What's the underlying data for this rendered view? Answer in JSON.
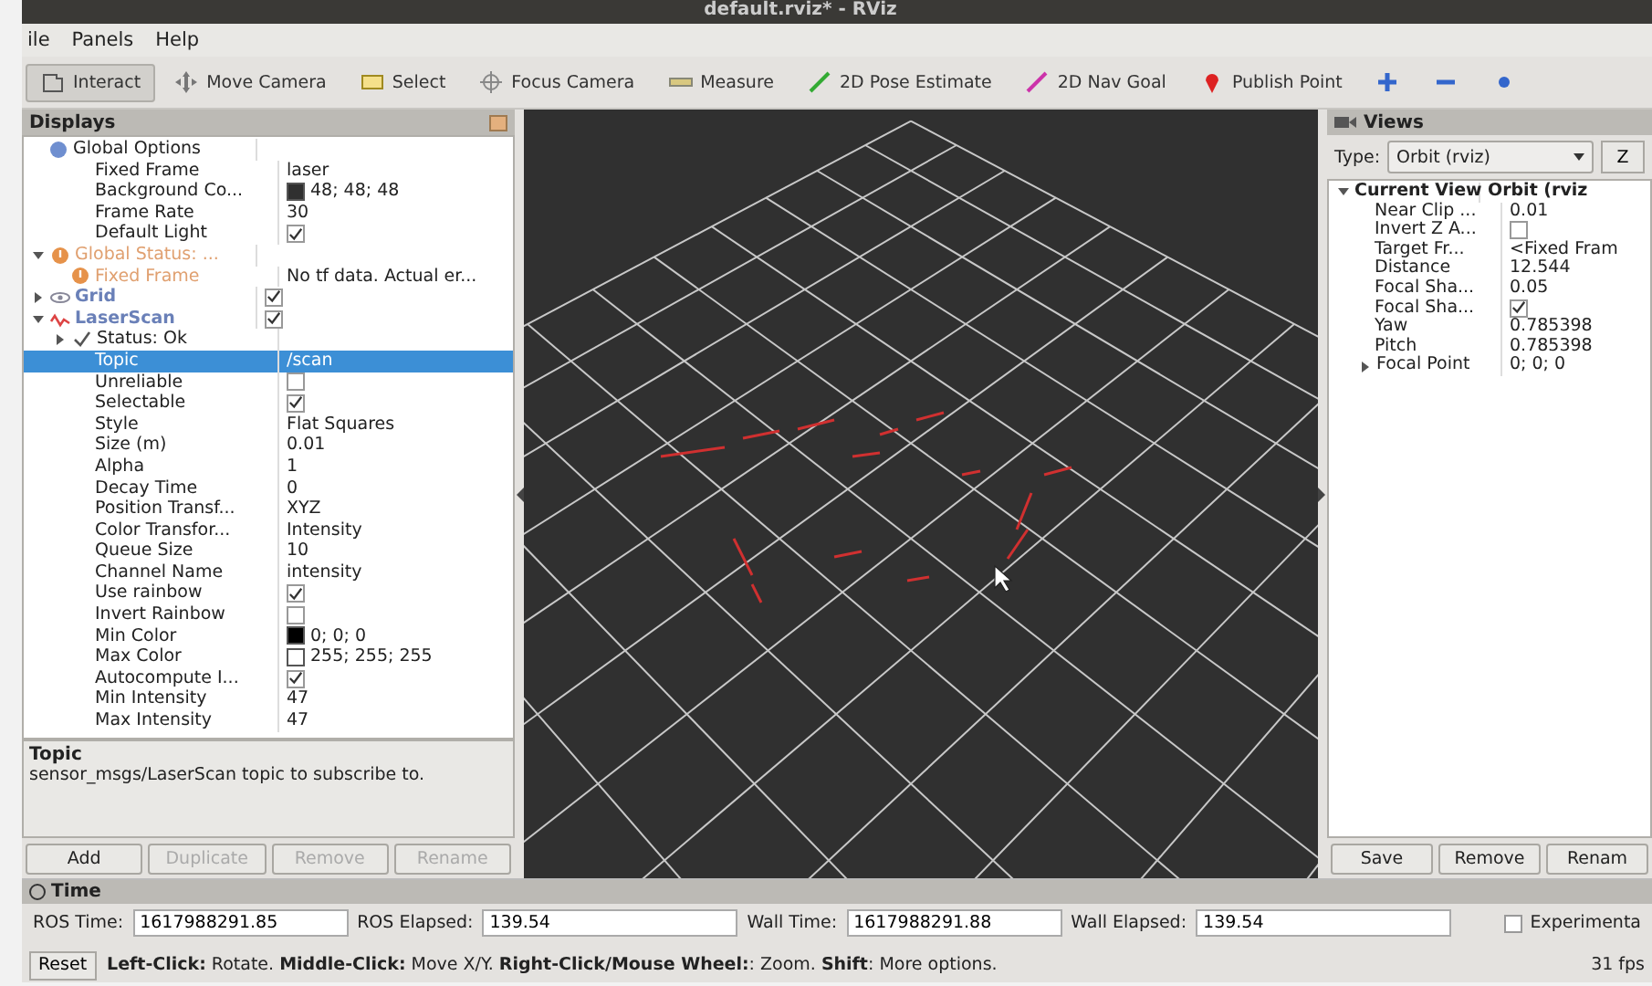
{
  "window": {
    "title": "default.rviz* - RViz"
  },
  "menu": [
    "ile",
    "Panels",
    "Help"
  ],
  "toolbar": [
    {
      "label": "Interact",
      "kind": "interact",
      "selected": true
    },
    {
      "label": "Move Camera",
      "kind": "move",
      "selected": false
    },
    {
      "label": "Select",
      "kind": "select",
      "selected": false
    },
    {
      "label": "Focus Camera",
      "kind": "focus",
      "selected": false
    },
    {
      "label": "Measure",
      "kind": "measure",
      "selected": false
    },
    {
      "label": "2D Pose Estimate",
      "kind": "pose",
      "selected": false
    },
    {
      "label": "2D Nav Goal",
      "kind": "goal",
      "selected": false
    },
    {
      "label": "Publish Point",
      "kind": "pin",
      "selected": false
    },
    {
      "kind": "plus",
      "selected": false
    },
    {
      "kind": "minus",
      "selected": false
    },
    {
      "kind": "dot",
      "selected": false
    }
  ],
  "displays": {
    "title": "Displays",
    "items": [
      {
        "label": "Global Options",
        "kind": "group",
        "selected": false,
        "children": [
          {
            "label": "Fixed Frame",
            "kind": "property",
            "value": "laser",
            "selected": false
          },
          {
            "label": "Background Co...",
            "kind": "property",
            "color": "#303030",
            "value": "48; 48; 48",
            "selected": false
          },
          {
            "label": "Frame Rate",
            "kind": "property",
            "value": "30",
            "selected": false
          },
          {
            "label": "Default Light",
            "kind": "property",
            "checked": true,
            "selected": false
          }
        ]
      },
      {
        "label": "Global Status: ...",
        "kind": "warning",
        "expanded": true,
        "selected": false,
        "children": [
          {
            "label": "Fixed Frame",
            "kind": "warning",
            "value": "No tf data.  Actual er...",
            "selected": false
          }
        ]
      },
      {
        "label": "Grid",
        "kind": "grid",
        "checked": true,
        "expanded": false,
        "selected": false
      },
      {
        "label": "LaserScan",
        "kind": "scan",
        "checked": true,
        "expanded": true,
        "selected": false,
        "children": [
          {
            "label": "Status: Ok",
            "kind": "ok",
            "expanded": false,
            "selected": false
          },
          {
            "label": "Topic",
            "kind": "property",
            "value": "/scan",
            "selected": true
          },
          {
            "label": "Unreliable",
            "kind": "property",
            "checked": false,
            "selected": false
          },
          {
            "label": "Selectable",
            "kind": "property",
            "checked": true,
            "selected": false
          },
          {
            "label": "Style",
            "kind": "property",
            "value": "Flat Squares",
            "selected": false
          },
          {
            "label": "Size (m)",
            "kind": "property",
            "value": "0.01",
            "selected": false
          },
          {
            "label": "Alpha",
            "kind": "property",
            "value": "1",
            "selected": false
          },
          {
            "label": "Decay Time",
            "kind": "property",
            "value": "0",
            "selected": false
          },
          {
            "label": "Position Transf...",
            "kind": "property",
            "value": "XYZ",
            "selected": false
          },
          {
            "label": "Color Transfor...",
            "kind": "property",
            "value": "Intensity",
            "selected": false
          },
          {
            "label": "Queue Size",
            "kind": "property",
            "value": "10",
            "selected": false
          },
          {
            "label": "Channel Name",
            "kind": "property",
            "value": "intensity",
            "selected": false
          },
          {
            "label": "Use rainbow",
            "kind": "property",
            "checked": true,
            "selected": false
          },
          {
            "label": "Invert Rainbow",
            "kind": "property",
            "checked": false,
            "selected": false
          },
          {
            "label": "Min Color",
            "kind": "property",
            "color": "#000000",
            "value": "0; 0; 0",
            "selected": false
          },
          {
            "label": "Max Color",
            "kind": "property",
            "color": "#ffffff",
            "value": "255; 255; 255",
            "selected": false
          },
          {
            "label": "Autocompute I...",
            "kind": "property",
            "checked": true,
            "selected": false
          },
          {
            "label": "Min Intensity",
            "kind": "property",
            "value": "47",
            "selected": false
          },
          {
            "label": "Max Intensity",
            "kind": "property",
            "value": "47",
            "selected": false
          }
        ]
      }
    ],
    "description": {
      "title": "Topic",
      "text": "sensor_msgs/LaserScan topic to subscribe to."
    },
    "buttons": [
      {
        "label": "Add",
        "disabled": false
      },
      {
        "label": "Duplicate",
        "disabled": true
      },
      {
        "label": "Remove",
        "disabled": true
      },
      {
        "label": "Rename",
        "disabled": true
      }
    ]
  },
  "views": {
    "title": "Views",
    "type_label": "Type:",
    "type_value": "Orbit (rviz)",
    "zero_button": "Z",
    "items": [
      {
        "label": "Current View",
        "kind": "heading",
        "value": "Orbit (rviz",
        "expanded": true,
        "children": [
          {
            "label": "Near Clip ...",
            "kind": "property",
            "value": "0.01"
          },
          {
            "label": "Invert Z A...",
            "kind": "property",
            "checked": false
          },
          {
            "label": "Target Fr...",
            "kind": "property",
            "value": "<Fixed Fram"
          },
          {
            "label": "Distance",
            "kind": "property",
            "value": "12.544"
          },
          {
            "label": "Focal Sha...",
            "kind": "property",
            "value": "0.05"
          },
          {
            "label": "Focal Sha...",
            "kind": "property",
            "checked": true
          },
          {
            "label": "Yaw",
            "kind": "property",
            "value": "0.785398"
          },
          {
            "label": "Pitch",
            "kind": "property",
            "value": "0.785398"
          },
          {
            "label": "Focal Point",
            "kind": "property",
            "value": "0; 0; 0",
            "expanded": false
          }
        ]
      }
    ],
    "buttons": [
      "Save",
      "Remove",
      "Renam"
    ]
  },
  "time": {
    "title": "Time",
    "fields": [
      {
        "label": "ROS Time:",
        "value": "1617988291.85"
      },
      {
        "label": "ROS Elapsed:",
        "value": "139.54"
      },
      {
        "label": "Wall Time:",
        "value": "1617988291.88"
      },
      {
        "label": "Wall Elapsed:",
        "value": "139.54"
      }
    ],
    "experimental": {
      "label": "Experimenta",
      "checked": false
    }
  },
  "status_bar": {
    "reset": "Reset",
    "hint": "**Left-Click:** Rotate. **Middle-Click:** Move X/Y. **Right-Click/Mouse Wheel:**: Zoom. **Shift**: More options.",
    "fps": "31 fps"
  }
}
